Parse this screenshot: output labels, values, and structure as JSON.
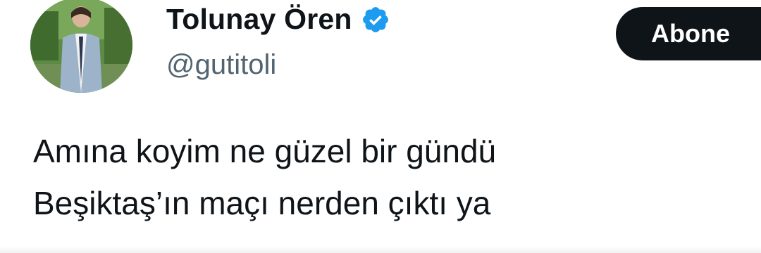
{
  "author": {
    "display_name": "Tolunay Ören",
    "handle": "@gutitoli",
    "verified_icon": "verified-badge-icon",
    "badge_color": "#1d9bf0"
  },
  "actions": {
    "follow_label": "Abone"
  },
  "tweet": {
    "lines": [
      "Amına koyim ne güzel bir gündü",
      "Beşiktaş’ın maçı nerden çıktı ya"
    ]
  },
  "colors": {
    "text": "#0f1419",
    "secondary_text": "#536471",
    "button_bg": "#0f1419",
    "button_text": "#ffffff"
  }
}
